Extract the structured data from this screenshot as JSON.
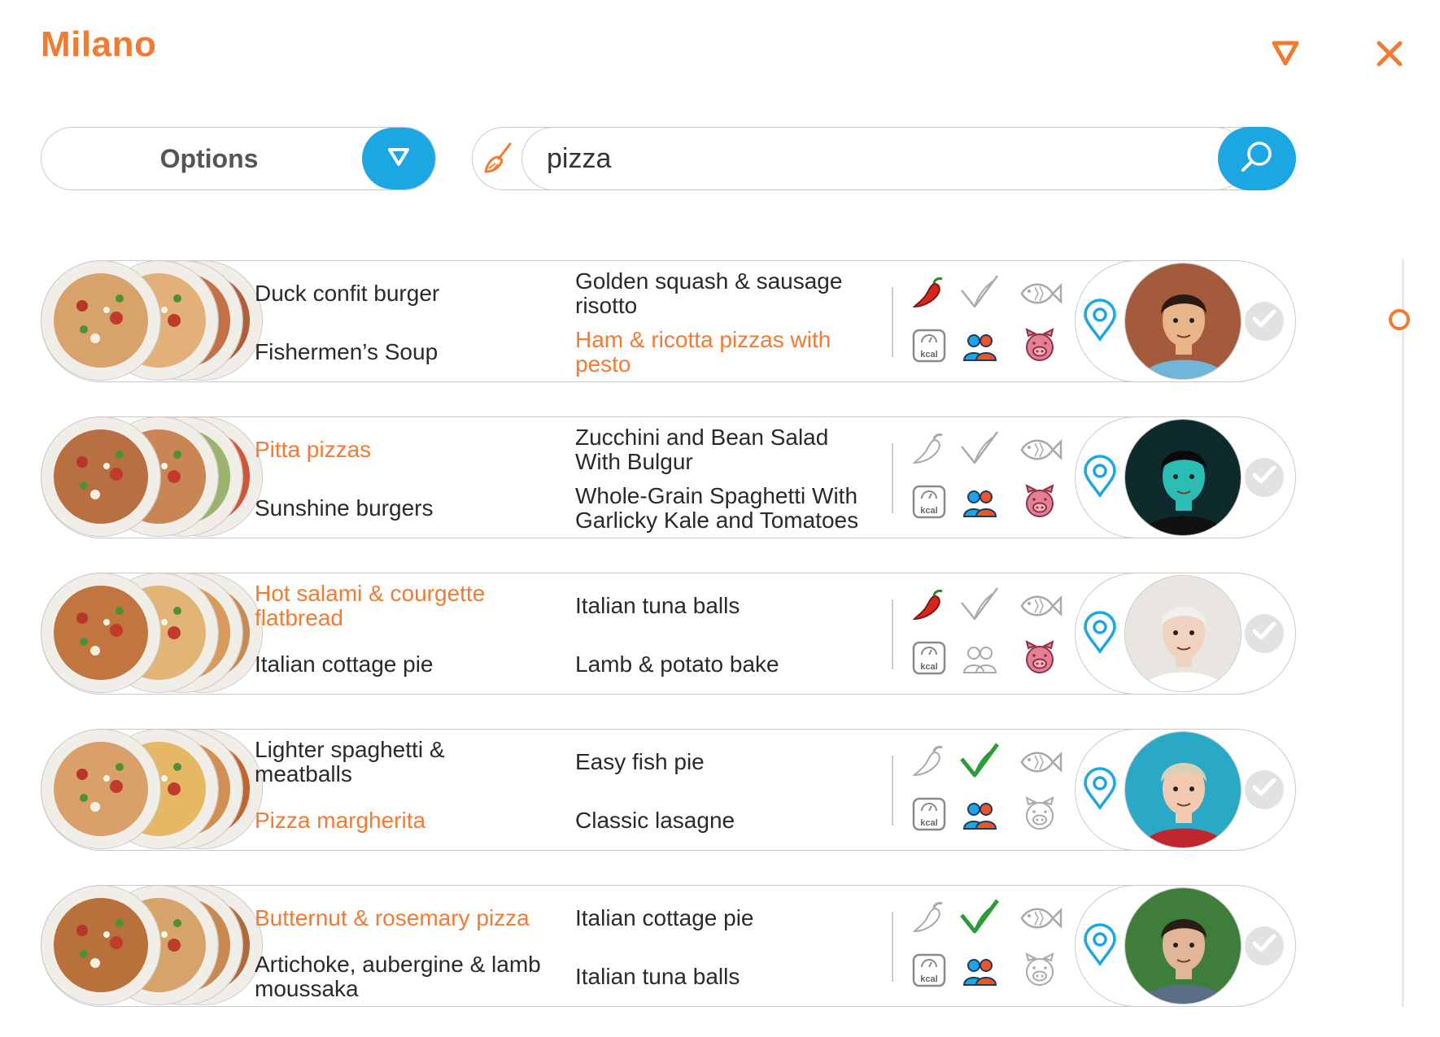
{
  "header": {
    "title": "Milano",
    "menu_icon": "triangle-down-icon",
    "close_icon": "close-x-icon"
  },
  "options": {
    "label": "Options",
    "icon": "triangle-down-icon"
  },
  "search": {
    "value": "pizza",
    "clear_icon": "broom-icon",
    "go_icon": "search-icon"
  },
  "colors": {
    "accent": "#f47a32",
    "blue": "#1ca6e2",
    "border": "#c9c9c9",
    "red_chili": "#d9261c",
    "green_check": "#2e9b3a",
    "pink_pig": "#e57f93"
  },
  "rows": [
    {
      "col1": [
        {
          "text": "Duck confit burger",
          "highlight": false
        },
        {
          "text": "Fishermen’s Soup",
          "highlight": false
        }
      ],
      "col2": [
        {
          "text": "Golden squash & sausage risotto",
          "highlight": false
        },
        {
          "text": "Ham & ricotta pizzas with pesto",
          "highlight": true
        }
      ],
      "spicy": true,
      "vegetarian": false,
      "fish": false,
      "kcal": true,
      "group": true,
      "pork": true,
      "plates": [
        "#d8a36a",
        "#e4b07a",
        "#c6704a",
        "#b05d3a"
      ],
      "avatar": {
        "bg": "#a35b3c",
        "skin": "#e8b48a",
        "shirt": "#6fb6d8",
        "hair": "#2b1a12"
      }
    },
    {
      "col1": [
        {
          "text": "Pitta pizzas",
          "highlight": true
        },
        {
          "text": "Sunshine burgers",
          "highlight": false
        }
      ],
      "col2": [
        {
          "text": "Zucchini and Bean Salad With Bulgur",
          "highlight": false
        },
        {
          "text": "Whole-Grain Spaghetti With Garlicky Kale and Tomatoes",
          "highlight": false
        }
      ],
      "spicy": false,
      "vegetarian": false,
      "fish": false,
      "kcal": true,
      "group": true,
      "pork": true,
      "plates": [
        "#b86f42",
        "#c98654",
        "#9bb46d",
        "#d2553a"
      ],
      "avatar": {
        "bg": "#0f2a2c",
        "skin": "#2bbcb3",
        "shirt": "#111111",
        "hair": "#0a0a0a"
      }
    },
    {
      "col1": [
        {
          "text": "Hot salami & courgette flatbread",
          "highlight": true
        },
        {
          "text": "Italian cottage pie",
          "highlight": false
        }
      ],
      "col2": [
        {
          "text": "Italian tuna balls",
          "highlight": false
        },
        {
          "text": "Lamb & potato bake",
          "highlight": false
        }
      ],
      "spicy": true,
      "vegetarian": false,
      "fish": false,
      "kcal": true,
      "group": false,
      "pork": true,
      "plates": [
        "#c2763f",
        "#e2b476",
        "#d79a5c",
        "#c98a52"
      ],
      "avatar": {
        "bg": "#e9e6e2",
        "skin": "#efd2bf",
        "shirt": "#ffffff",
        "hair": "#f0f0f0"
      }
    },
    {
      "col1": [
        {
          "text": "Lighter spaghetti & meatballs",
          "highlight": false
        },
        {
          "text": "Pizza margherita",
          "highlight": true
        }
      ],
      "col2": [
        {
          "text": "Easy fish pie",
          "highlight": false
        },
        {
          "text": "Classic lasagne",
          "highlight": false
        }
      ],
      "spicy": false,
      "vegetarian": true,
      "fish": false,
      "kcal": true,
      "group": true,
      "pork": false,
      "plates": [
        "#d9a06a",
        "#e6b765",
        "#d38e52",
        "#c3632e"
      ],
      "avatar": {
        "bg": "#2aa9c6",
        "skin": "#f1c9b0",
        "shirt": "#c0272d",
        "hair": "#d8cfb8"
      }
    },
    {
      "col1": [
        {
          "text": "Butternut & rosemary pizza",
          "highlight": true
        },
        {
          "text": "Artichoke, aubergine & lamb moussaka",
          "highlight": false
        }
      ],
      "col2": [
        {
          "text": "Italian cottage pie",
          "highlight": false
        },
        {
          "text": "Italian tuna balls",
          "highlight": false
        }
      ],
      "spicy": false,
      "vegetarian": true,
      "fish": false,
      "kcal": true,
      "group": true,
      "pork": false,
      "plates": [
        "#b8713a",
        "#d6a36a",
        "#c98953",
        "#b06a3a"
      ],
      "avatar": {
        "bg": "#3f7d3a",
        "skin": "#e3b597",
        "shirt": "#5a6f86",
        "hair": "#2a1d15"
      }
    }
  ]
}
